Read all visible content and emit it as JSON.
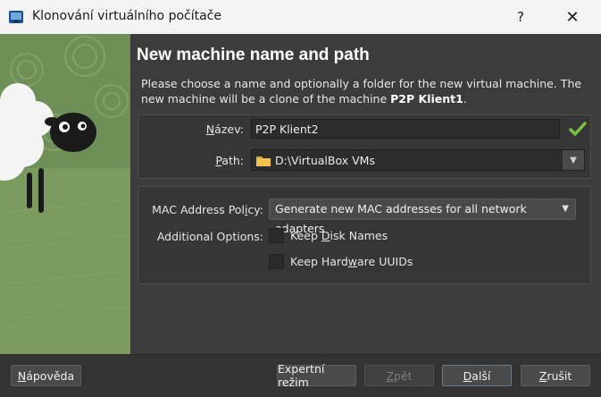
{
  "window": {
    "title": "Klonování virtuálního počítače",
    "help_glyph": "?",
    "close_glyph": "✕"
  },
  "page": {
    "title": "New machine name and path",
    "description_prefix": "Please choose a name and optionally a folder for the new virtual machine. The new machine will be a clone of the machine ",
    "source_machine": "P2P Klient1",
    "description_suffix": "."
  },
  "form": {
    "name_label_first": "N",
    "name_label_rest": "ázev:",
    "name_value": "P2P Klient2",
    "path_label_first": "P",
    "path_label_rest": "ath:",
    "path_value": "D:\\VirtualBox VMs"
  },
  "options": {
    "mac_label_pre": "MAC Address Pol",
    "mac_label_u": "i",
    "mac_label_post": "cy:",
    "mac_value": "Generate new MAC addresses for all network adapters",
    "additional_label": "Additional Options:",
    "keep_disk_pre": "Keep ",
    "keep_disk_u": "D",
    "keep_disk_post": "isk Names",
    "keep_hw_pre": "Keep Hard",
    "keep_hw_u": "w",
    "keep_hw_post": "are UUIDs"
  },
  "buttons": {
    "help_u": "N",
    "help_rest": "ápověda",
    "expert": "Expertní režim",
    "back_u": "Z",
    "back_rest": "pět",
    "next_u": "D",
    "next_rest": "alší",
    "cancel_u": "Z",
    "cancel_rest": "rušit"
  },
  "colors": {
    "accent_check": "#7cc242",
    "folder": "#f2c14e",
    "background": "#3c3c3c"
  },
  "icons": {
    "app": "virtualbox-icon",
    "valid": "check-icon",
    "folder": "folder-icon",
    "dropdown": "chevron-down-icon"
  }
}
